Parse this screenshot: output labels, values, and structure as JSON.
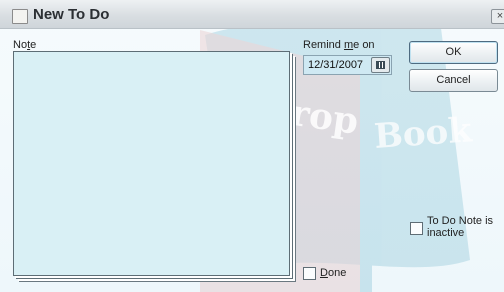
{
  "window": {
    "title": "New To Do",
    "close_glyph": "×"
  },
  "note": {
    "label_pre": "No",
    "label_mnemonic": "t",
    "label_post": "e",
    "value": ""
  },
  "remind": {
    "label_pre": "Remind ",
    "label_mnemonic": "m",
    "label_post": "e on",
    "date": "12/31/2007"
  },
  "buttons": {
    "ok": "OK",
    "cancel": "Cancel"
  },
  "inactive": {
    "label_line1": "To Do Note is",
    "label_line2": "inactive",
    "checked": false
  },
  "done": {
    "label_mnemonic": "D",
    "label_post": "one",
    "checked": false
  },
  "watermark": {
    "text_1": "Drop",
    "text_2": "Book"
  },
  "colors": {
    "note_bg": "#d9f0f5",
    "watermark_red": "#c4342e"
  }
}
